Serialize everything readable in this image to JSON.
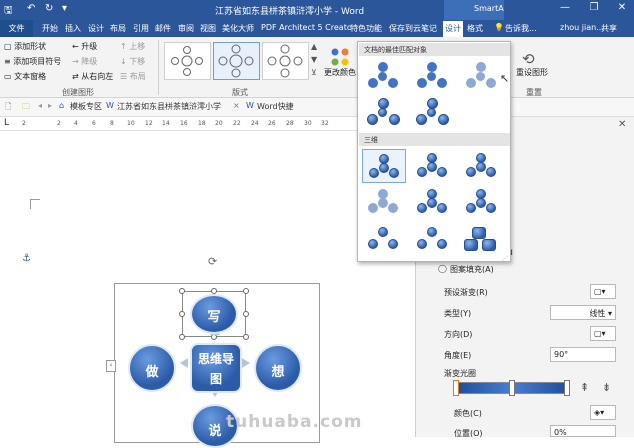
{
  "window": {
    "title": "江苏省如东县栟茶镇浒澪小学 - Word",
    "context_tab": "SmartA...",
    "controls": {
      "minimize": "—",
      "restore": "❐",
      "close": "✕"
    }
  },
  "tabs": {
    "file": "文件",
    "items": [
      "开始",
      "插入",
      "设计",
      "布局",
      "引用",
      "邮件",
      "审阅",
      "视图",
      "美化大师",
      "PDF Architect 5 Creatc",
      "特色功能",
      "保存到云笔记",
      "设计",
      "格式"
    ],
    "tell_me": "告诉我...",
    "user": "zhou jian...",
    "share": "共享"
  },
  "ribbon": {
    "create_group": {
      "label": "创建图形",
      "add_shape": "添加形状",
      "add_bullet": "添加项目符号",
      "text_pane": "文本窗格",
      "promote": "升级",
      "demote": "降级",
      "right_to_left": "从右向左",
      "move_up": "上移",
      "move_down": "下移",
      "layout": "布局"
    },
    "layouts_label": "版式",
    "change_colors": "更改颜色",
    "reset_graphic": "重设图形",
    "reset_label": "重置"
  },
  "gallery": {
    "section1": "文档的最佳匹配对象",
    "section2": "三维"
  },
  "doctabs": [
    "模板专区",
    "江苏省如东县栟茶镇浒澪小学",
    "Word快捷"
  ],
  "ruler_ticks": [
    "2",
    "4",
    "2",
    "4",
    "6",
    "8",
    "10",
    "12",
    "14",
    "16",
    "18",
    "20",
    "22",
    "24",
    "26",
    "28",
    "30",
    "32"
  ],
  "diagram": {
    "center": "思维导图",
    "top": "写",
    "left": "做",
    "right": "想",
    "bottom": "说"
  },
  "panel": {
    "pattern_fill": "图案填充(A)",
    "preset_gradient": "预设渐变(R)",
    "type_label": "类型(Y)",
    "type_value": "线性",
    "direction_label": "方向(D)",
    "angle_label": "角度(E)",
    "angle_value": "90°",
    "stops_label": "渐变光圈",
    "color_label": "颜色(C)",
    "position_label": "位置(O)",
    "position_value": "0%"
  },
  "watermark": "tuhuaba.com"
}
